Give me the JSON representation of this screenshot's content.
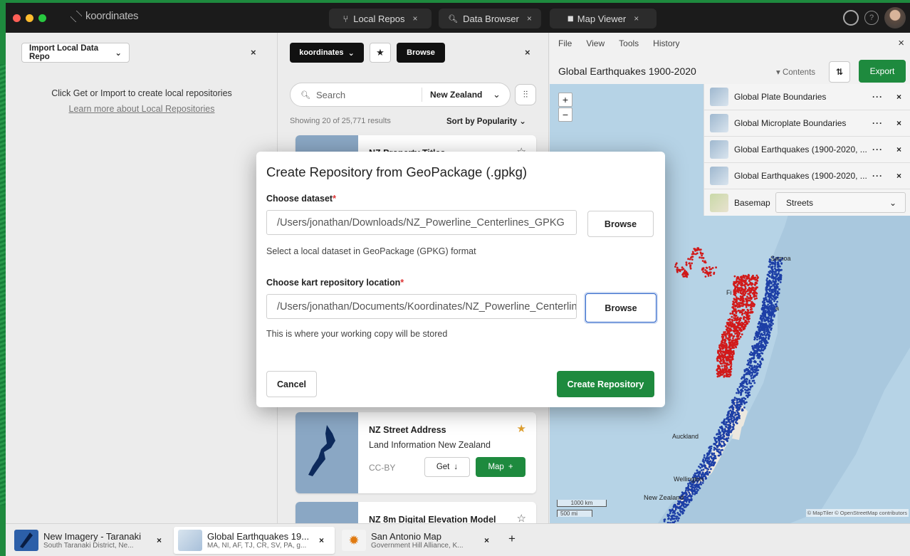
{
  "window": {
    "logo_text": "koordinates",
    "traffic_colors": [
      "#fe5f57",
      "#febc2e",
      "#28c840"
    ]
  },
  "top_tabs": [
    {
      "label": "Local Repos",
      "icon": "branch-icon",
      "glyph": "⑂"
    },
    {
      "label": "Data Browser",
      "icon": "search-icon",
      "glyph": "🔍︎"
    },
    {
      "label": "Map Viewer",
      "icon": "bookshelf-icon",
      "glyph": "▮▮"
    }
  ],
  "close_glyph": "×",
  "pane1": {
    "select_label": "Import Local Data Repo",
    "hint": "Click Get or Import to create local repositories",
    "link": "Learn more about Local Repositories"
  },
  "pane2": {
    "brand_button": "koordinates",
    "browse_label": "Browse",
    "search_placeholder": "Search",
    "region": "New Zealand",
    "results": "Showing 20 of 25,771 results",
    "sort": "Sort by Popularity",
    "cards": [
      {
        "title": "NZ Property Titles"
      },
      {
        "title": "NZ Street Address",
        "subtitle": "Land Information New Zealand",
        "license": "CC-BY",
        "get": "Get",
        "map": "Map"
      },
      {
        "title": "NZ 8m Digital Elevation Model"
      }
    ]
  },
  "pane3": {
    "menu": [
      "File",
      "View",
      "Tools",
      "History"
    ],
    "map_title": "Global Earthquakes 1900-2020",
    "contents": "Contents",
    "export": "Export",
    "layers": [
      "Global Plate Boundaries",
      "Global Microplate Boundaries",
      "Global Earthquakes (1900-2020, ...",
      "Global Earthquakes (1900-2020, ..."
    ],
    "basemap_label": "Basemap",
    "basemap_value": "Streets",
    "labels": {
      "samoa": "Samoa",
      "fiji": "Fi",
      "tonga": "a",
      "auckland": "Auckland",
      "wellington": "Wellington",
      "nz": "New Zealand"
    },
    "scale_km": "1000 km",
    "scale_mi": "500 mi",
    "attribution": "© MapTiler © OpenStreetMap contributors",
    "zoom_in": "+",
    "zoom_out": "−"
  },
  "modal": {
    "title": "Create Repository from GeoPackage (.gpkg)",
    "dataset_label": "Choose dataset",
    "dataset_value": "/Users/jonathan/Downloads/NZ_Powerline_Centerlines_GPKG",
    "dataset_help": "Select a local dataset in GeoPackage (GPKG) format",
    "location_label": "Choose kart repository location",
    "location_value": "/Users/jonathan/Documents/Koordinates/NZ_Powerline_Centerlines",
    "location_help": "This is where your working copy will be stored",
    "browse": "Browse",
    "cancel": "Cancel",
    "create": "Create Repository",
    "required_mark": "*"
  },
  "bottom_tabs": [
    {
      "title": "New Imagery - Taranaki",
      "subtitle": "South Taranaki District, Ne..."
    },
    {
      "title": "Global Earthquakes 19...",
      "subtitle": "MA, NI, AF, TJ, CR, SV, PA, g..."
    },
    {
      "title": "San Antonio Map",
      "subtitle": "Government Hill Alliance, K..."
    }
  ],
  "add_tab": "+",
  "colors": {
    "green": "#1e8a3e",
    "quake_red": "#d11a1a",
    "quake_blue": "#1d3fa6"
  }
}
